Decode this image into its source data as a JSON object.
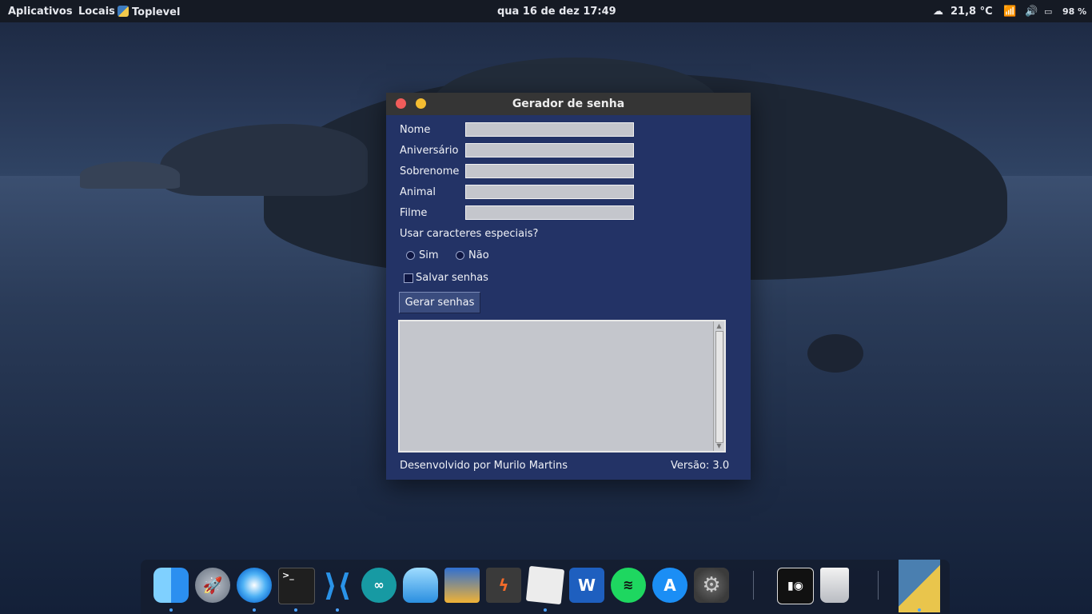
{
  "topbar": {
    "applications": "Aplicativos",
    "places": "Locais",
    "app_name": "Toplevel",
    "clock": "qua 16 de dez  17:49",
    "temperature": "21,8 °C",
    "battery": "98 %"
  },
  "window": {
    "title": "Gerador de senha",
    "fields": [
      {
        "label": "Nome",
        "value": ""
      },
      {
        "label": "Aniversário",
        "value": ""
      },
      {
        "label": "Sobrenome",
        "value": ""
      },
      {
        "label": "Animal",
        "value": ""
      },
      {
        "label": "Filme",
        "value": ""
      }
    ],
    "question": "Usar caracteres especiais?",
    "radio_yes": "Sim",
    "radio_no": "Não",
    "checkbox_save": "Salvar senhas",
    "generate_button": "Gerar senhas",
    "output_text": "",
    "footer_author": "Desenvolvido por Murilo Martins",
    "footer_version": "Versão: 3.0"
  },
  "dock": {
    "apps": [
      "finder-icon",
      "launchpad-icon",
      "safari-icon",
      "terminal-icon",
      "vscode-icon",
      "arduino-icon",
      "cloud-settings-icon",
      "presentation-icon",
      "sublime-icon",
      "text-editor-icon",
      "word-icon",
      "spotify-icon",
      "app-store-icon",
      "system-preferences-icon",
      "media-icon",
      "trash-icon",
      "python-icon"
    ]
  }
}
